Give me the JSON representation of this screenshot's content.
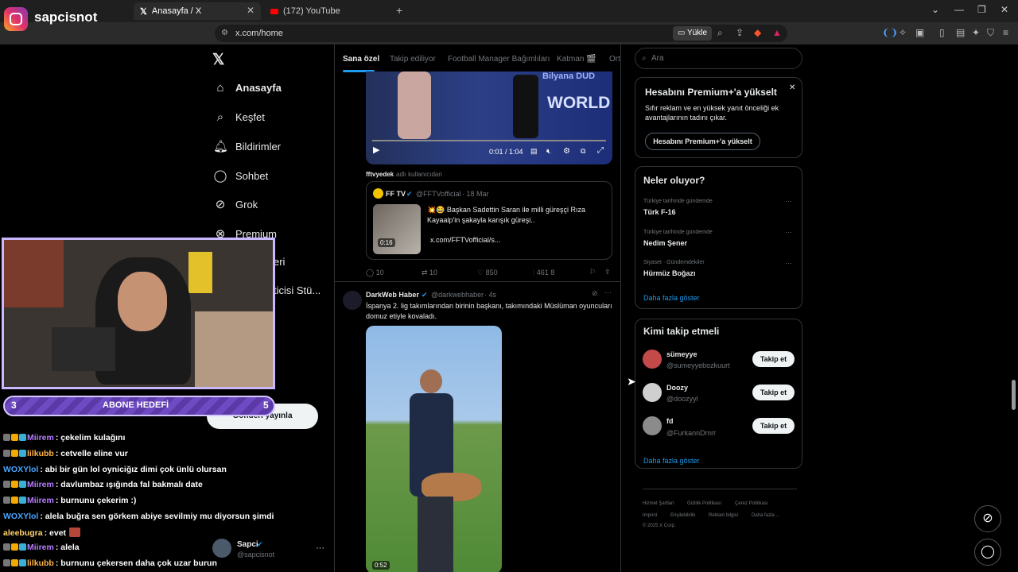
{
  "browser": {
    "tabs": [
      {
        "label": "Anasayfa / X",
        "active": true
      },
      {
        "label": "(172) YouTube",
        "active": false
      }
    ],
    "url": "x.com/home",
    "upload_label": "Yükle"
  },
  "overlay": {
    "streamer_handle": "sapcisnot",
    "goal": {
      "current": "3",
      "label": "ABONE HEDEFİ",
      "target": "5",
      "progress": 0.6
    },
    "chat": [
      {
        "user": "Miirem",
        "user_color": "#b57bff",
        "message": ": çekelim kulağını"
      },
      {
        "user": "lilkubb",
        "user_color": "#ffb347",
        "message": ": cetvelle eline vur"
      },
      {
        "user": "WOXYlol",
        "user_color": "#4aa3ff",
        "message": ": abi bir gün lol oyniciğız dimi çok ünlü olursan"
      },
      {
        "user": "Miirem",
        "user_color": "#b57bff",
        "message": ": davlumbaz ışığında fal bakmalı date"
      },
      {
        "user": "Miirem",
        "user_color": "#b57bff",
        "message": ": burnunu çekerim :)"
      },
      {
        "user": "WOXYlol",
        "user_color": "#4aa3ff",
        "message": ": alela buğra sen görkem abiye sevilmiy mu diyorsun şimdi"
      },
      {
        "user": "aleebugra",
        "user_color": "#ffd36a",
        "message": ": evet"
      },
      {
        "user": "Miirem",
        "user_color": "#b57bff",
        "message": ": alela"
      },
      {
        "user": "lilkubb",
        "user_color": "#ffb347",
        "message": ": burnunu çekersen daha çok uzar burun"
      }
    ]
  },
  "sidebar": {
    "items": [
      {
        "label": "Anasayfa",
        "icon": "home-icon"
      },
      {
        "label": "Keşfet",
        "icon": "search-icon"
      },
      {
        "label": "Bildirimler",
        "icon": "bell-icon"
      },
      {
        "label": "Sohbet",
        "icon": "chat-icon"
      },
      {
        "label": "Grok",
        "icon": "grok-icon"
      },
      {
        "label": "Premium",
        "icon": "premium-icon"
      },
      {
        "label": "eri",
        "icon": ""
      },
      {
        "label": "ticisi Stü...",
        "icon": ""
      }
    ],
    "post_button": "Gönderi yayınla",
    "profile": {
      "name": "Sapci",
      "handle": "@sapcisnot"
    }
  },
  "timeline": {
    "tabs": [
      "Sana özel",
      "Takip ediliyor",
      "Football Manager Bağımlıları",
      "Katman 🎬",
      "Ort"
    ],
    "post1": {
      "video_time": "0:01 / 1:04",
      "video_banner": "WORLD",
      "video_name": "Bilyana DUD",
      "via": "fftvyedek",
      "via_suffix": "adlı kullanıcıdan",
      "quote": {
        "name": "FF TV",
        "handle": "@FFTVofficial",
        "date": "· 18 Mar",
        "text_line1": "💥😂 Başkan Sadettin Saran ile milli güreşçi Rıza",
        "text_line2": "Kayaalp'in şakayla karışık güreşi..",
        "link": "x.com/FFTVofficial/s...",
        "thumb_time": "0:16"
      },
      "replies": "10",
      "reposts": "10",
      "likes": "850",
      "views": "461 8"
    },
    "post2": {
      "name": "DarkWeb Haber",
      "handle": "@darkwebhaber",
      "time": "· 4s",
      "text_line1": "İspanya 2. lig takımlarından birinin başkanı, takımındaki Müslüman oyuncuları",
      "text_line2": "domuz etiyle kovaladı.",
      "video_time": "0:52"
    }
  },
  "right": {
    "search_placeholder": "Ara",
    "premium": {
      "title": "Hesabını Premium+'a yükselt",
      "desc_line1": "Sıfır reklam ve en yüksek yanıt önceliği ek",
      "desc_line2": "avantajlarının tadını çıkar.",
      "button": "Hesabını Premium+'a yükselt"
    },
    "trends": {
      "title": "Neler oluyor?",
      "items": [
        {
          "context": "Türkiye tarihinde gündemde",
          "name": "Türk F-16"
        },
        {
          "context": "Türkiye tarihinde gündemde",
          "name": "Nedim Şener"
        },
        {
          "context": "Siyaset · Gündemdekiler",
          "name": "Hürmüz Boğazı"
        }
      ],
      "more": "Daha fazla göster"
    },
    "who_to_follow": {
      "title": "Kimi takip etmeli",
      "users": [
        {
          "name": "sümeyye",
          "handle": "@sumeyyebozkuurt",
          "button": "Takip et"
        },
        {
          "name": "Doozy",
          "handle": "@doozyyl",
          "button": "Takip et"
        },
        {
          "name": "fd",
          "handle": "@FurkannDmrr",
          "button": "Takip et"
        }
      ],
      "more": "Daha fazla göster"
    },
    "footer": {
      "links": [
        "Hizmet Şartları",
        "Gizlilik Politikası",
        "Çerez Politikası",
        "Imprint",
        "Erişilebilirlik",
        "Reklam bilgisi",
        "Daha fazla ..."
      ],
      "copyright": "© 2025 X Corp."
    }
  }
}
